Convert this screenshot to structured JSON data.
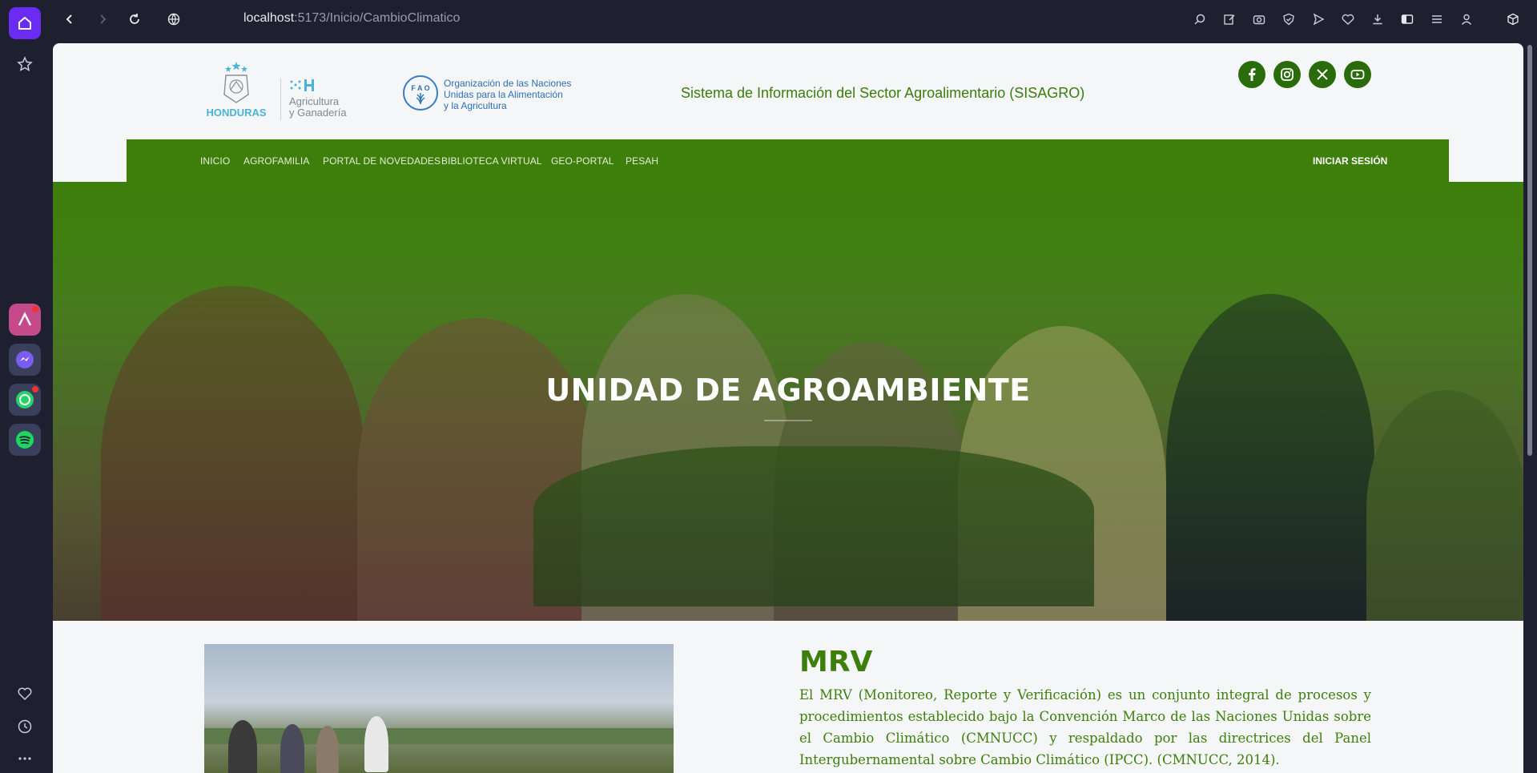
{
  "browser": {
    "url_host": "localhost",
    "url_path": ":5173/Inicio/CambioClimatico"
  },
  "header": {
    "hn_logo_text": "HONDURAS",
    "sag_logo_line1": "Agricultura",
    "sag_logo_line2": "y Ganadería",
    "fao_line1": "Organización de las Naciones",
    "fao_line2": "Unidas para la Alimentación",
    "fao_line3": "y la Agricultura",
    "system_title": "Sistema de Información del Sector Agroalimentario (SISAGRO)",
    "social": [
      "facebook-icon",
      "instagram-icon",
      "x-icon",
      "youtube-icon"
    ]
  },
  "nav": {
    "items": [
      "INICIO",
      "AGROFAMILIA",
      "PORTAL DE NOVEDADES",
      "BIBLIOTECA VIRTUAL",
      "GEO-PORTAL",
      "PESAH"
    ],
    "login": "INICIAR SESIÓN"
  },
  "hero": {
    "title": "UNIDAD DE AGROAMBIENTE"
  },
  "mrv": {
    "title": "MRV",
    "body": "El MRV (Monitoreo, Reporte y Verificación) es un conjunto integral de procesos y procedimientos establecido bajo la Convención Marco de las Naciones Unidas sobre el Cambio Climático (CMNUCC) y respaldado por las directrices del Panel Intergubernamental sobre Cambio Climático (IPCC). (CMNUCC, 2014)."
  },
  "colors": {
    "primary_green": "#3d7f0a",
    "browser_bg": "#1e2030",
    "accent_purple": "#6a2cf5"
  }
}
